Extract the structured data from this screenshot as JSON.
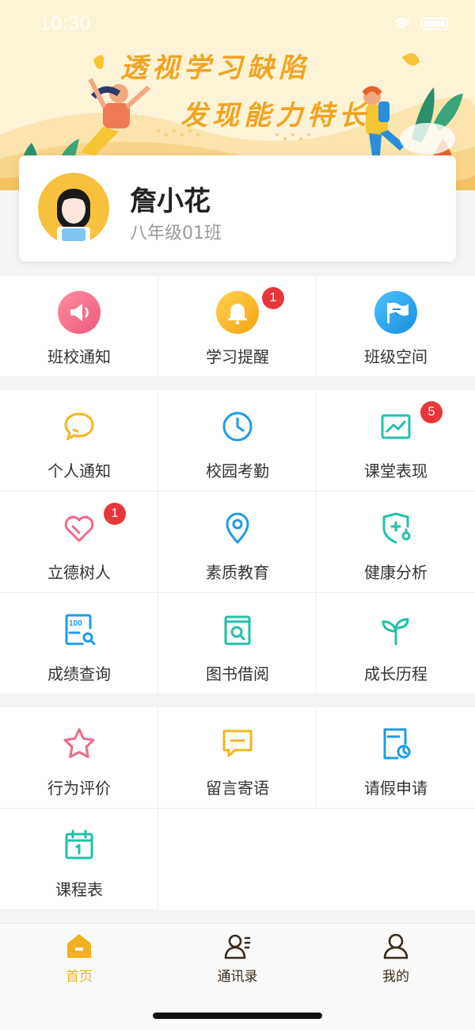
{
  "status_bar": {
    "time": "10:30"
  },
  "banner": {
    "slogan_line1": "透视学习缺陷",
    "slogan_line2": "发现能力特长"
  },
  "profile": {
    "name": "詹小花",
    "class": "八年级01班"
  },
  "colors": {
    "accent": "#f3b020",
    "badge": "#e8373b",
    "pink": "#f06a85",
    "blue": "#1e9be8",
    "teal": "#21c2a8",
    "orange": "#f5b51d"
  },
  "sections": [
    {
      "items": [
        {
          "label": "班校通知",
          "icon": "speaker-icon",
          "badge": null
        },
        {
          "label": "学习提醒",
          "icon": "bell-icon",
          "badge": "1"
        },
        {
          "label": "班级空间",
          "icon": "flag-icon",
          "badge": null
        }
      ]
    },
    {
      "items": [
        {
          "label": "个人通知",
          "icon": "chat-bubble-icon",
          "badge": null
        },
        {
          "label": "校园考勤",
          "icon": "clock-icon",
          "badge": null
        },
        {
          "label": "课堂表现",
          "icon": "chart-icon",
          "badge": "5"
        },
        {
          "label": "立德树人",
          "icon": "heart-icon",
          "badge": "1"
        },
        {
          "label": "素质教育",
          "icon": "location-pin-icon",
          "badge": null
        },
        {
          "label": "健康分析",
          "icon": "health-shield-icon",
          "badge": null
        },
        {
          "label": "成绩查询",
          "icon": "score-search-icon",
          "badge": null
        },
        {
          "label": "图书借阅",
          "icon": "book-search-icon",
          "badge": null
        },
        {
          "label": "成长历程",
          "icon": "sprout-icon",
          "badge": null
        }
      ]
    },
    {
      "items": [
        {
          "label": "行为评价",
          "icon": "star-icon",
          "badge": null
        },
        {
          "label": "留言寄语",
          "icon": "message-icon",
          "badge": null
        },
        {
          "label": "请假申请",
          "icon": "leave-form-icon",
          "badge": null
        },
        {
          "label": "课程表",
          "icon": "calendar-icon",
          "badge": null
        }
      ]
    }
  ],
  "tabbar": {
    "tabs": [
      {
        "label": "首页",
        "icon": "home-icon",
        "active": true
      },
      {
        "label": "通讯录",
        "icon": "contacts-icon",
        "active": false
      },
      {
        "label": "我的",
        "icon": "profile-icon",
        "active": false
      }
    ]
  }
}
